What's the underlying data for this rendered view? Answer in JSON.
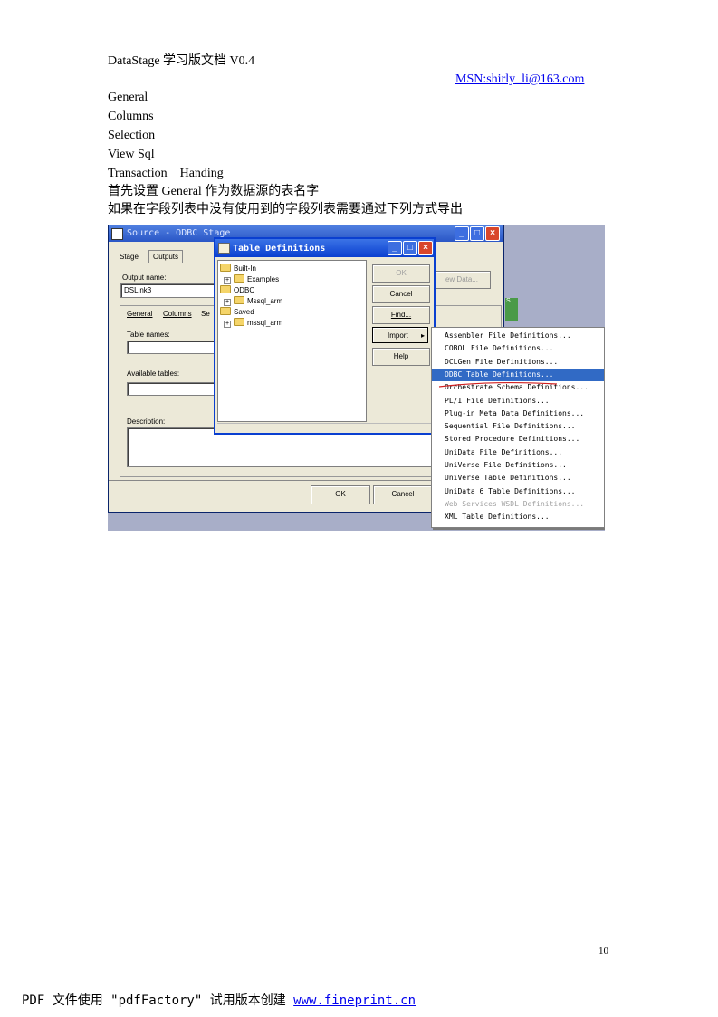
{
  "header": {
    "title": "DataStage 学习版文档 V0.4",
    "contact": "MSN:shirly_li@163.com"
  },
  "body_lines": [
    "General",
    "Columns",
    "Selection",
    "View Sql",
    "Transaction    Handing",
    "首先设置 General  作为数据源的表名字",
    "如果在字段列表中没有使用到的字段列表需要通过下列方式导出"
  ],
  "screenshot": {
    "source_window": {
      "title": "Source - ODBC Stage",
      "tabs": [
        "Stage",
        "Outputs"
      ],
      "output_name_label": "Output name:",
      "output_name_value": "DSLink3",
      "inner_tabs": [
        "General",
        "Columns",
        "Se"
      ],
      "table_names_label": "Table names:",
      "available_tables_label": "Available tables:",
      "description_label": "Description:",
      "ok": "OK",
      "cancel": "Cancel",
      "view_data": "ew Data...",
      "side_label": "S"
    },
    "table_definitions": {
      "title": "Table Definitions",
      "tree": [
        {
          "label": "Built-In",
          "level": 0,
          "expander": false
        },
        {
          "label": "Examples",
          "level": 1,
          "expander": true
        },
        {
          "label": "ODBC",
          "level": 0,
          "expander": false
        },
        {
          "label": "Mssql_arm",
          "level": 1,
          "expander": true
        },
        {
          "label": "Saved",
          "level": 0,
          "expander": false
        },
        {
          "label": "mssql_arm",
          "level": 1,
          "expander": true
        }
      ],
      "buttons": {
        "ok": "OK",
        "cancel": "Cancel",
        "find": "Find...",
        "import": "Import",
        "help": "Help"
      }
    },
    "import_menu": {
      "items": [
        {
          "label": "Assembler File Definitions...",
          "highlighted": false,
          "disabled": false
        },
        {
          "label": "COBOL File Definitions...",
          "highlighted": false,
          "disabled": false
        },
        {
          "label": "DCLGen File Definitions...",
          "highlighted": false,
          "disabled": false
        },
        {
          "label": "ODBC Table Definitions...",
          "highlighted": true,
          "disabled": false
        },
        {
          "label": "Orchestrate Schema Definitions...",
          "highlighted": false,
          "disabled": false
        },
        {
          "label": "PL/I File Definitions...",
          "highlighted": false,
          "disabled": false
        },
        {
          "label": "Plug-in Meta Data Definitions...",
          "highlighted": false,
          "disabled": false
        },
        {
          "label": "Sequential File Definitions...",
          "highlighted": false,
          "disabled": false
        },
        {
          "label": "Stored Procedure Definitions...",
          "highlighted": false,
          "disabled": false
        },
        {
          "label": "UniData File Definitions...",
          "highlighted": false,
          "disabled": false
        },
        {
          "label": "UniVerse File Definitions...",
          "highlighted": false,
          "disabled": false
        },
        {
          "label": "UniVerse Table Definitions...",
          "highlighted": false,
          "disabled": false
        },
        {
          "label": "UniData 6 Table Definitions...",
          "highlighted": false,
          "disabled": false
        },
        {
          "label": "Web Services WSDL Definitions...",
          "highlighted": false,
          "disabled": true
        },
        {
          "label": "XML Table Definitions...",
          "highlighted": false,
          "disabled": false
        }
      ]
    }
  },
  "page_number": "10",
  "footer": {
    "text": "PDF 文件使用 \"pdfFactory\" 试用版本创建 ",
    "link": "www.fineprint.cn"
  },
  "colors": {
    "titlebar": "#2a56c6",
    "highlight": "#316ac5",
    "dialog_bg": "#ece9d8",
    "link": "#0000ee"
  }
}
